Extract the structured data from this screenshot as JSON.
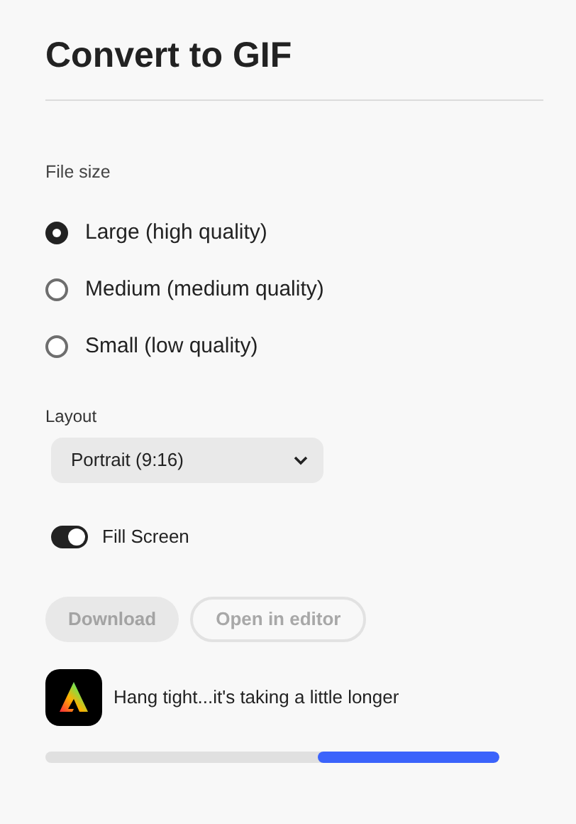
{
  "title": "Convert to GIF",
  "file_size": {
    "label": "File size",
    "options": [
      {
        "label": "Large (high quality)",
        "selected": true
      },
      {
        "label": "Medium (medium quality)",
        "selected": false
      },
      {
        "label": "Small (low quality)",
        "selected": false
      }
    ]
  },
  "layout": {
    "label": "Layout",
    "value": "Portrait (9:16)"
  },
  "fill_screen": {
    "label": "Fill Screen",
    "on": true
  },
  "buttons": [
    {
      "label": "Download",
      "kind": "primary",
      "disabled": true
    },
    {
      "label": "Open in editor",
      "kind": "outline",
      "disabled": true
    }
  ],
  "status": {
    "message": "Hang tight...it's taking a little longer"
  },
  "progress": {
    "level": 0.4
  }
}
